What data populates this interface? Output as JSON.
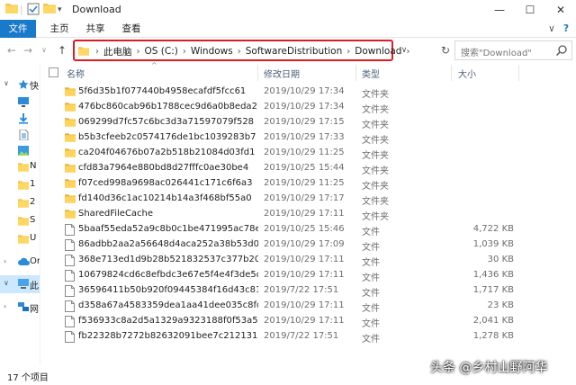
{
  "window": {
    "title": "Download",
    "min_glyph": "—",
    "max_glyph": "☐",
    "close_glyph": "✕",
    "dropdown_glyph": "▾",
    "pipe_glyph": "|"
  },
  "ribbon": {
    "tabs": [
      "文件",
      "主页",
      "共享",
      "查看"
    ],
    "expand_glyph": "∨",
    "help_glyph": "?",
    "accent": "#1979ca"
  },
  "nav": {
    "back_glyph": "←",
    "forward_glyph": "→",
    "recent_glyph": "∨",
    "up_glyph": "↑",
    "breadcrumbs": [
      "此电脑",
      "OS (C:)",
      "Windows",
      "SoftwareDistribution",
      "Download"
    ],
    "sep_glyph": "›",
    "addr_dropdown_glyph": "∨",
    "refresh_glyph": "↻",
    "highlight_color": "#e01b24"
  },
  "search": {
    "placeholder": "搜索\"Download\""
  },
  "sidebar": {
    "quick_access_label": "快",
    "items": [
      {
        "label": "",
        "icon": "desktop-icon"
      },
      {
        "label": "",
        "icon": "download-arrow-icon"
      },
      {
        "label": "",
        "icon": "document-icon"
      },
      {
        "label": "",
        "icon": "picture-icon"
      },
      {
        "label": "N",
        "icon": "folder-icon"
      },
      {
        "label": "1",
        "icon": "folder-icon"
      },
      {
        "label": "2",
        "icon": "folder-icon"
      },
      {
        "label": "S",
        "icon": "folder-icon"
      },
      {
        "label": "U",
        "icon": "folder-icon"
      }
    ],
    "onedrive_label": "Or",
    "thispc_label": "此",
    "network_label": "网",
    "expand_glyph": "›",
    "open_glyph": "∨"
  },
  "columns": {
    "name": "名称",
    "date": "修改日期",
    "type": "类型",
    "size": "大小",
    "sort_glyph": "^"
  },
  "files": [
    {
      "name": "5f6d35b1f077440b4958ecafdf5fcc61",
      "date": "2019/10/29 17:34",
      "type": "文件夹",
      "size": "",
      "kind": "folder"
    },
    {
      "name": "476bc860cab96b1788cec9d6a0b8eda2",
      "date": "2019/10/29 17:34",
      "type": "文件夹",
      "size": "",
      "kind": "folder"
    },
    {
      "name": "069299d7fc57c6bc3d3a71597079f528",
      "date": "2019/10/29 17:15",
      "type": "文件夹",
      "size": "",
      "kind": "folder"
    },
    {
      "name": "b5b3cfeeb2c0574176de1bc1039283b7",
      "date": "2019/10/29 17:33",
      "type": "文件夹",
      "size": "",
      "kind": "folder"
    },
    {
      "name": "ca204f04676b07a2b518b21084d03fd1",
      "date": "2019/10/29 11:25",
      "type": "文件夹",
      "size": "",
      "kind": "folder"
    },
    {
      "name": "cfd83a7964e880bd8d27fffc0ae30be4",
      "date": "2019/10/25 15:44",
      "type": "文件夹",
      "size": "",
      "kind": "folder"
    },
    {
      "name": "f07ced998a9698ac026441c171c6f6a3",
      "date": "2019/10/29 11:25",
      "type": "文件夹",
      "size": "",
      "kind": "folder"
    },
    {
      "name": "fd140d36c1ac10214b14a3f468bf55a0",
      "date": "2019/10/29 17:17",
      "type": "文件夹",
      "size": "",
      "kind": "folder"
    },
    {
      "name": "SharedFileCache",
      "date": "2019/10/29 17:11",
      "type": "文件夹",
      "size": "",
      "kind": "folder"
    },
    {
      "name": "5baaf55eda52a9c8b0c1be471995ac78e...",
      "date": "2019/10/25 15:46",
      "type": "文件",
      "size": "4,722 KB",
      "kind": "file"
    },
    {
      "name": "86adbb2aa2a56648d4aca252a38b53d0...",
      "date": "2019/10/29 17:09",
      "type": "文件",
      "size": "1,039 KB",
      "kind": "file"
    },
    {
      "name": "368e713ed1d9b28b521832537c377b20...",
      "date": "2019/10/29 17:11",
      "type": "文件",
      "size": "30 KB",
      "kind": "file"
    },
    {
      "name": "10679824cd6c8efbdc3e67e5f4e4f3de5d...",
      "date": "2019/10/29 17:11",
      "type": "文件",
      "size": "1,436 KB",
      "kind": "file"
    },
    {
      "name": "36596411b50b920f09445384f16d43c81...",
      "date": "2019/7/22 17:51",
      "type": "文件",
      "size": "1,717 KB",
      "kind": "file"
    },
    {
      "name": "d358a67a4583359dea1aa41dee035c8fd...",
      "date": "2019/10/29 17:11",
      "type": "文件",
      "size": "23 KB",
      "kind": "file"
    },
    {
      "name": "f536933c8a2d5a1329a9323188f0f53a5c...",
      "date": "2019/10/29 17:11",
      "type": "文件",
      "size": "2,041 KB",
      "kind": "file"
    },
    {
      "name": "fb22328b7272b82632091bee7c212131...",
      "date": "2019/7/22 17:51",
      "type": "文件",
      "size": "1,278 KB",
      "kind": "file"
    }
  ],
  "status": {
    "count": "17 个项目"
  },
  "watermark": "头条 @乡村山野阿华"
}
